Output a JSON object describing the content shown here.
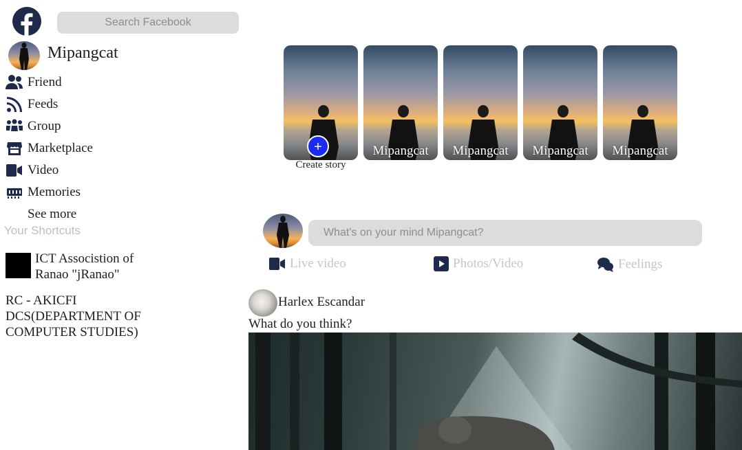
{
  "header": {
    "search_placeholder": "Search Facebook",
    "logo_icon": "facebook-logo-icon",
    "brand_color": "#1e2a4a"
  },
  "profile": {
    "name": "Mipangcat"
  },
  "sidebar": {
    "items": [
      {
        "label": "Friend",
        "icon": "friends-icon"
      },
      {
        "label": "Feeds",
        "icon": "rss-icon"
      },
      {
        "label": "Group",
        "icon": "group-icon"
      },
      {
        "label": "Marketplace",
        "icon": "store-icon"
      },
      {
        "label": "Video",
        "icon": "video-camera-icon"
      },
      {
        "label": "Memories",
        "icon": "memory-icon"
      },
      {
        "label": "See more",
        "icon": ""
      }
    ],
    "shortcuts_title": "Your Shortcuts",
    "shortcuts": [
      {
        "label": "ICT Associstion of Ranao \"jRanao\""
      },
      {
        "label": "RC - AKICFI DCS(DEPARTMENT OF COMPUTER STUDIES)"
      }
    ]
  },
  "stories": {
    "create_label": "Create story",
    "plus": "+",
    "items": [
      {
        "name": "Mipangcat"
      },
      {
        "name": "Mipangcat"
      },
      {
        "name": "Mipangcat"
      },
      {
        "name": "Mipangcat"
      }
    ]
  },
  "composer": {
    "placeholder": "What's on your mind Mipangcat?",
    "actions": [
      {
        "label": "Live video",
        "icon": "video-camera-icon"
      },
      {
        "label": "Photos/Video",
        "icon": "play-square-icon"
      },
      {
        "label": "Feelings",
        "icon": "comments-icon"
      }
    ]
  },
  "post": {
    "author": "Harlex Escandar",
    "text": "What do you think?"
  }
}
